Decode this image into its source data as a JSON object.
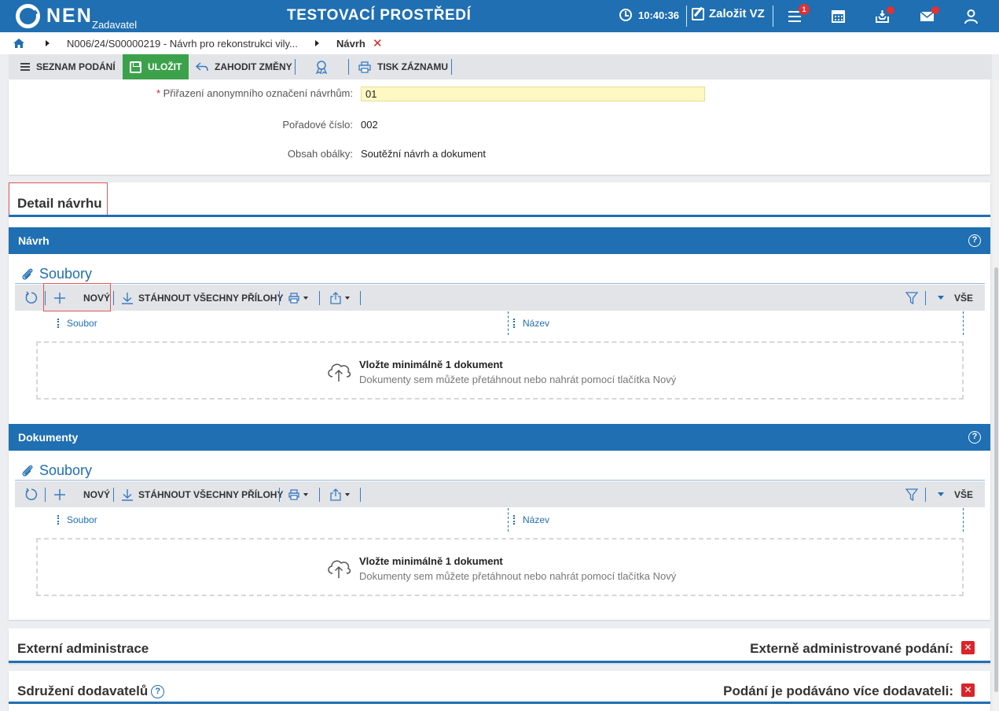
{
  "app": {
    "logo_text": "NEN",
    "logo_sub": "Zadavatel",
    "environment_title": "TESTOVACÍ PROSTŘEDÍ",
    "clock_time": "10:40:36",
    "create_vz_label": "Založit VZ",
    "tasks_badge": "1",
    "brand_color": "#1f6fb2"
  },
  "breadcrumb": {
    "path_item": "N006/24/S00000219 - Návrh pro rekonstrukci vily...",
    "current": "Návrh"
  },
  "toolbar": {
    "list_label": "SEZNAM PODÁNÍ",
    "save_label": "ULOŽIT",
    "discard_label": "ZAHODIT ZMĚNY",
    "print_label": "TISK ZÁZNAMU"
  },
  "form": {
    "anon_label": "Přiřazení anonymního označení návrhům:",
    "anon_value": "01",
    "order_label": "Pořadové číslo:",
    "order_value": "002",
    "envelope_label": "Obsah obálky:",
    "envelope_value": "Soutěžní návrh a dokument"
  },
  "detail": {
    "title": "Detail návrhu",
    "sections": [
      {
        "title": "Návrh",
        "files_heading": "Soubory",
        "new_label": "NOVÝ",
        "download_label": "STÁHNOUT VŠECHNY PŘÍLOHY",
        "filter_all_label": "VŠE",
        "col_file": "Soubor",
        "col_name": "Název",
        "drop_title": "Vložte minimálně 1 dokument",
        "drop_sub": "Dokumenty sem můžete přetáhnout nebo nahrát pomocí tlačítka Nový"
      },
      {
        "title": "Dokumenty",
        "files_heading": "Soubory",
        "new_label": "NOVÝ",
        "download_label": "STÁHNOUT VŠECHNY PŘÍLOHY",
        "filter_all_label": "VŠE",
        "col_file": "Soubor",
        "col_name": "Název",
        "drop_title": "Vložte minimálně 1 dokument",
        "drop_sub": "Dokumenty sem můžete přetáhnout nebo nahrát pomocí tlačítka Nový"
      }
    ]
  },
  "external_admin": {
    "title": "Externí administrace",
    "right_label": "Externě administrované podání:",
    "value_icon": "red-x-icon"
  },
  "supplier_assoc": {
    "title": "Sdružení dodavatelů",
    "right_label": "Podání je podáváno více dodavateli:",
    "value_icon": "red-x-icon"
  }
}
